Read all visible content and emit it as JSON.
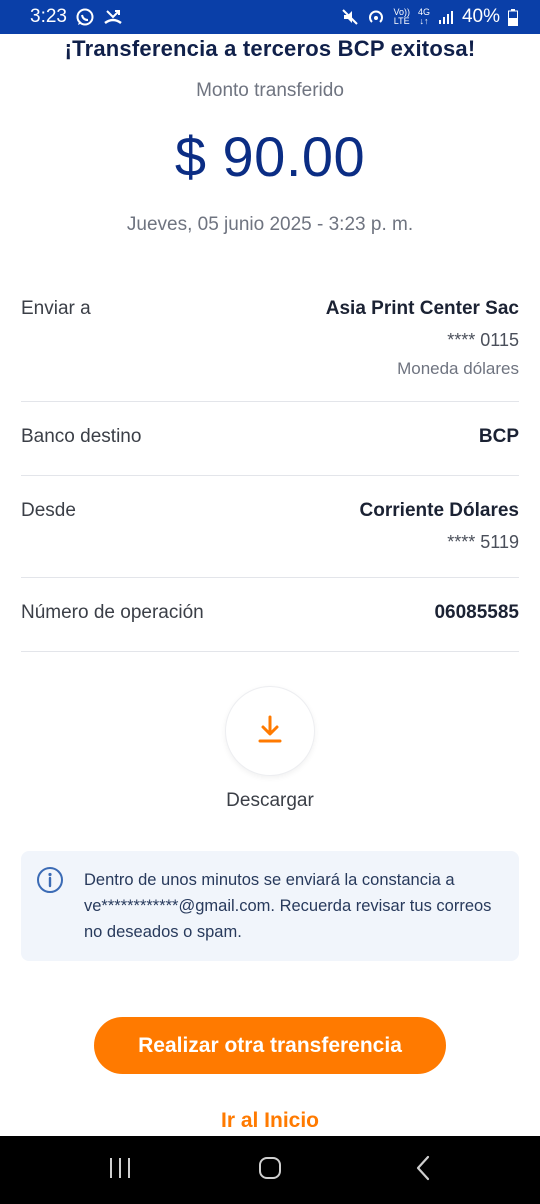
{
  "status_bar": {
    "time": "3:23",
    "network_top": "Vo))",
    "network_bottom": "LTE",
    "gen_top": "4G",
    "gen_bottom": "↓↑",
    "battery": "40%"
  },
  "header": {
    "title": "¡Transferencia a terceros BCP exitosa!"
  },
  "amount": {
    "label": "Monto transferido",
    "value": "$ 90.00",
    "datetime": "Jueves, 05 junio 2025 - 3:23 p. m."
  },
  "details": {
    "recipient": {
      "label": "Enviar a",
      "name": "Asia Print Center Sac",
      "account": "**** 0115",
      "currency": "Moneda dólares"
    },
    "bank": {
      "label": "Banco destino",
      "value": "BCP"
    },
    "from": {
      "label": "Desde",
      "account_type": "Corriente Dólares",
      "account": "**** 5119"
    },
    "operation": {
      "label": "Número de operación",
      "value": "06085585"
    }
  },
  "download": {
    "label": "Descargar"
  },
  "info": {
    "message": "Dentro de unos minutos se enviará la constancia a ve************@gmail.com. Recuerda revisar tus correos no deseados o spam."
  },
  "actions": {
    "primary": "Realizar otra transferencia",
    "secondary": "Ir al Inicio"
  },
  "colors": {
    "status_bar": "#0a3fa8",
    "amount": "#0b2d84",
    "accent": "#ff7a00",
    "info_bg": "#f1f5fb"
  }
}
